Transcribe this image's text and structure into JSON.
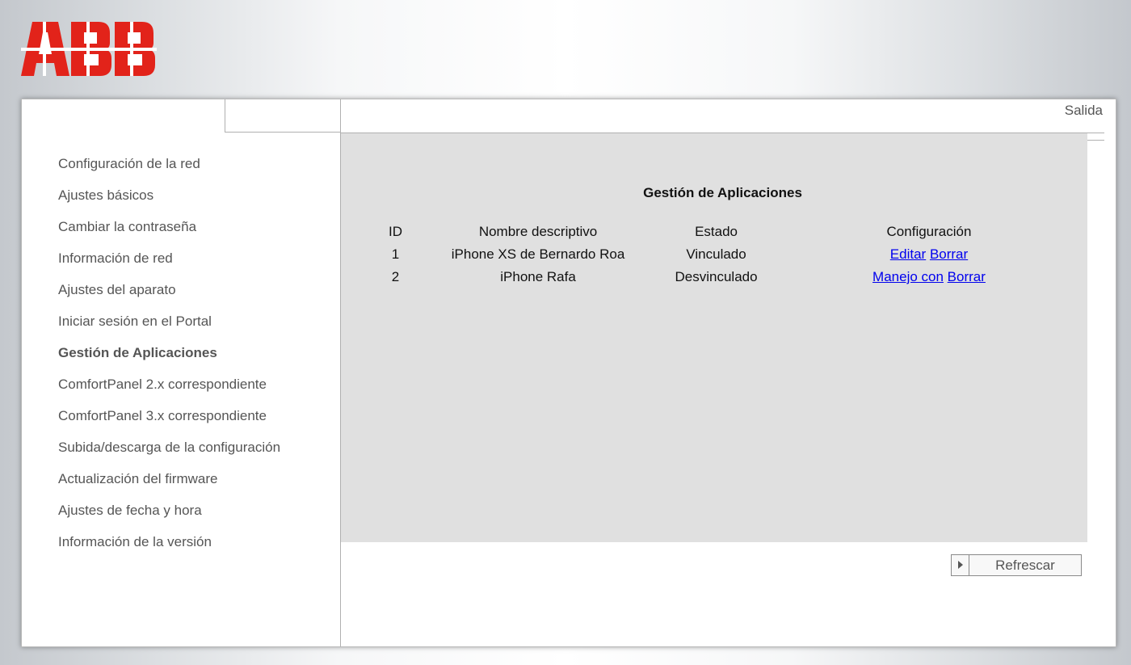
{
  "brand": {
    "logo_text": "ABB",
    "logo_color": "#e2231a"
  },
  "header": {
    "logout_label": "Salida"
  },
  "sidebar": {
    "items": [
      {
        "label": "Configuración de la red",
        "active": false
      },
      {
        "label": "Ajustes básicos",
        "active": false
      },
      {
        "label": "Cambiar la contraseña",
        "active": false
      },
      {
        "label": "Información de red",
        "active": false
      },
      {
        "label": "Ajustes del aparato",
        "active": false
      },
      {
        "label": "Iniciar sesión en el Portal",
        "active": false
      },
      {
        "label": "Gestión de Aplicaciones",
        "active": true
      },
      {
        "label": "ComfortPanel 2.x correspondiente",
        "active": false
      },
      {
        "label": "ComfortPanel 3.x correspondiente",
        "active": false
      },
      {
        "label": "Subida/descarga de la configuración",
        "active": false
      },
      {
        "label": "Actualización del firmware",
        "active": false
      },
      {
        "label": "Ajustes de fecha y hora",
        "active": false
      },
      {
        "label": "Información de la versión",
        "active": false
      }
    ]
  },
  "main": {
    "title": "Gestión de Aplicaciones",
    "table": {
      "columns": [
        "ID",
        "Nombre descriptivo",
        "Estado",
        "Configuración"
      ],
      "rows": [
        {
          "id": "1",
          "name": "iPhone XS de Bernardo Roa",
          "status": "Vinculado",
          "actions": [
            "Editar",
            "Borrar"
          ]
        },
        {
          "id": "2",
          "name": "iPhone Rafa",
          "status": "Desvinculado",
          "actions": [
            "Manejo con",
            "Borrar"
          ]
        }
      ]
    },
    "refresh_label": "Refrescar"
  },
  "colors": {
    "content_bg": "#e0e0e0",
    "link": "#0000ee",
    "nav_text": "#555555"
  }
}
